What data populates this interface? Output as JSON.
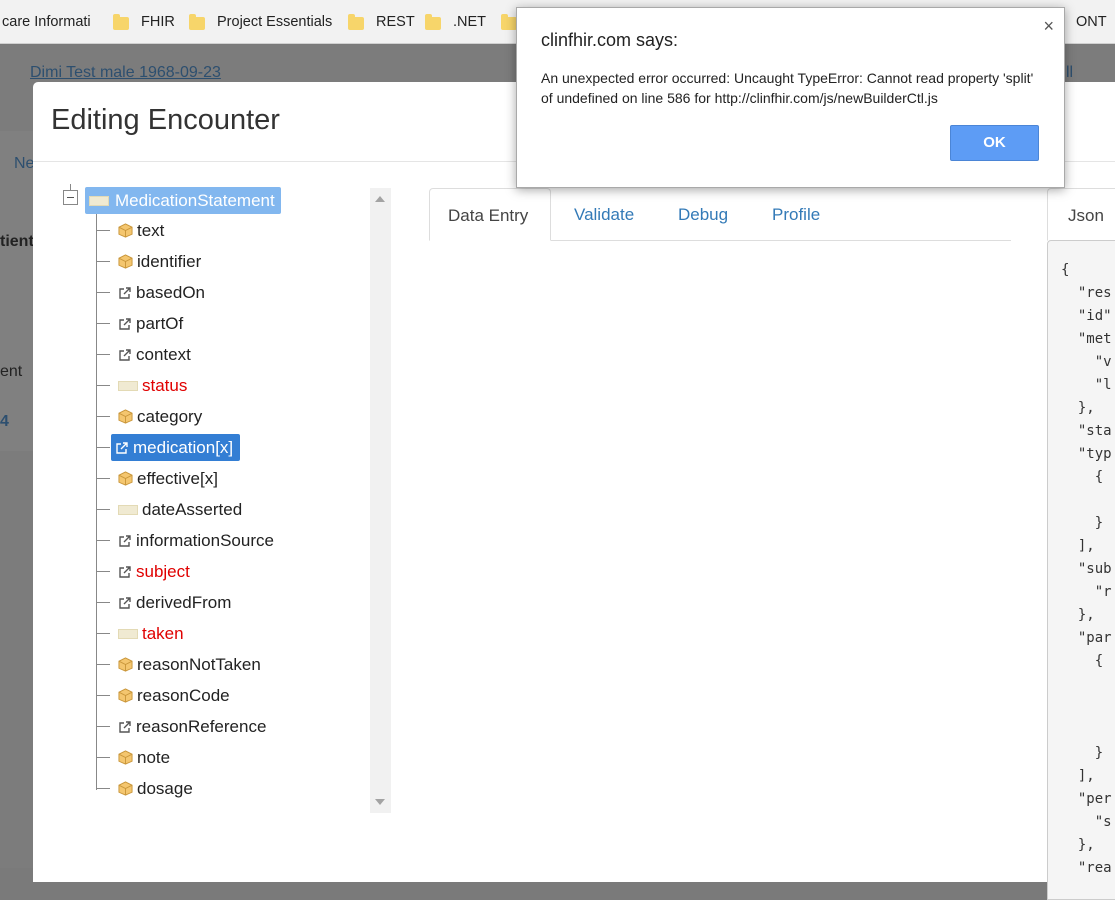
{
  "bookmarks": {
    "items": [
      "care Informati",
      "FHIR",
      "Project Essentials",
      "REST",
      ".NET"
    ],
    "right_fragment": "ONT"
  },
  "background": {
    "patient_link": "Dimi Test male 1968-09-23",
    "right_link": "ll",
    "fragment_ne": "Ne",
    "fragment_tient": "tient",
    "fragment_ent": "ent",
    "fragment_4": "4"
  },
  "modal": {
    "title": "Editing Encounter"
  },
  "tree": {
    "root": "MedicationStatement",
    "nodes": [
      {
        "label": "text",
        "icon": "cube-icon",
        "color": "normal"
      },
      {
        "label": "identifier",
        "icon": "cube-icon",
        "color": "normal"
      },
      {
        "label": "basedOn",
        "icon": "external-link-icon",
        "color": "normal"
      },
      {
        "label": "partOf",
        "icon": "external-link-icon",
        "color": "normal"
      },
      {
        "label": "context",
        "icon": "external-link-icon",
        "color": "normal"
      },
      {
        "label": "status",
        "icon": "folder-icon",
        "color": "required"
      },
      {
        "label": "category",
        "icon": "cube-icon",
        "color": "normal"
      },
      {
        "label": "medication[x]",
        "icon": "external-link-icon",
        "color": "selected"
      },
      {
        "label": "effective[x]",
        "icon": "cube-icon",
        "color": "normal"
      },
      {
        "label": "dateAsserted",
        "icon": "folder-icon",
        "color": "normal"
      },
      {
        "label": "informationSource",
        "icon": "external-link-icon",
        "color": "normal"
      },
      {
        "label": "subject",
        "icon": "external-link-icon",
        "color": "required"
      },
      {
        "label": "derivedFrom",
        "icon": "external-link-icon",
        "color": "normal"
      },
      {
        "label": "taken",
        "icon": "folder-icon",
        "color": "required"
      },
      {
        "label": "reasonNotTaken",
        "icon": "cube-icon",
        "color": "normal"
      },
      {
        "label": "reasonCode",
        "icon": "cube-icon",
        "color": "normal"
      },
      {
        "label": "reasonReference",
        "icon": "external-link-icon",
        "color": "normal"
      },
      {
        "label": "note",
        "icon": "cube-icon",
        "color": "normal"
      },
      {
        "label": "dosage",
        "icon": "cube-icon",
        "color": "normal"
      }
    ]
  },
  "tabs": {
    "data_entry": "Data Entry",
    "validate": "Validate",
    "debug": "Debug",
    "profile": "Profile",
    "json": "Json"
  },
  "json_preview": "{\n  \"res\n  \"id\"\n  \"met\n    \"v\n    \"l\n  },\n  \"sta\n  \"typ\n    {\n\n    }\n  ],\n  \"sub\n    \"r\n  },\n  \"par\n    {\n\n\n\n    }\n  ],\n  \"per\n    \"s\n  },\n  \"rea",
  "dialog": {
    "title": "clinfhir.com says:",
    "message": "An unexpected error occurred: Uncaught TypeError: Cannot read property 'split' of undefined on line 586 for http://clinfhir.com/js/newBuilderCtl.js",
    "ok": "OK",
    "close": "×"
  },
  "colors": {
    "selected_bg": "#337ed4",
    "root_bg": "#82b7ef",
    "required_text": "#e00000",
    "link": "#337ab7",
    "ok_button": "#5d9cf5"
  }
}
